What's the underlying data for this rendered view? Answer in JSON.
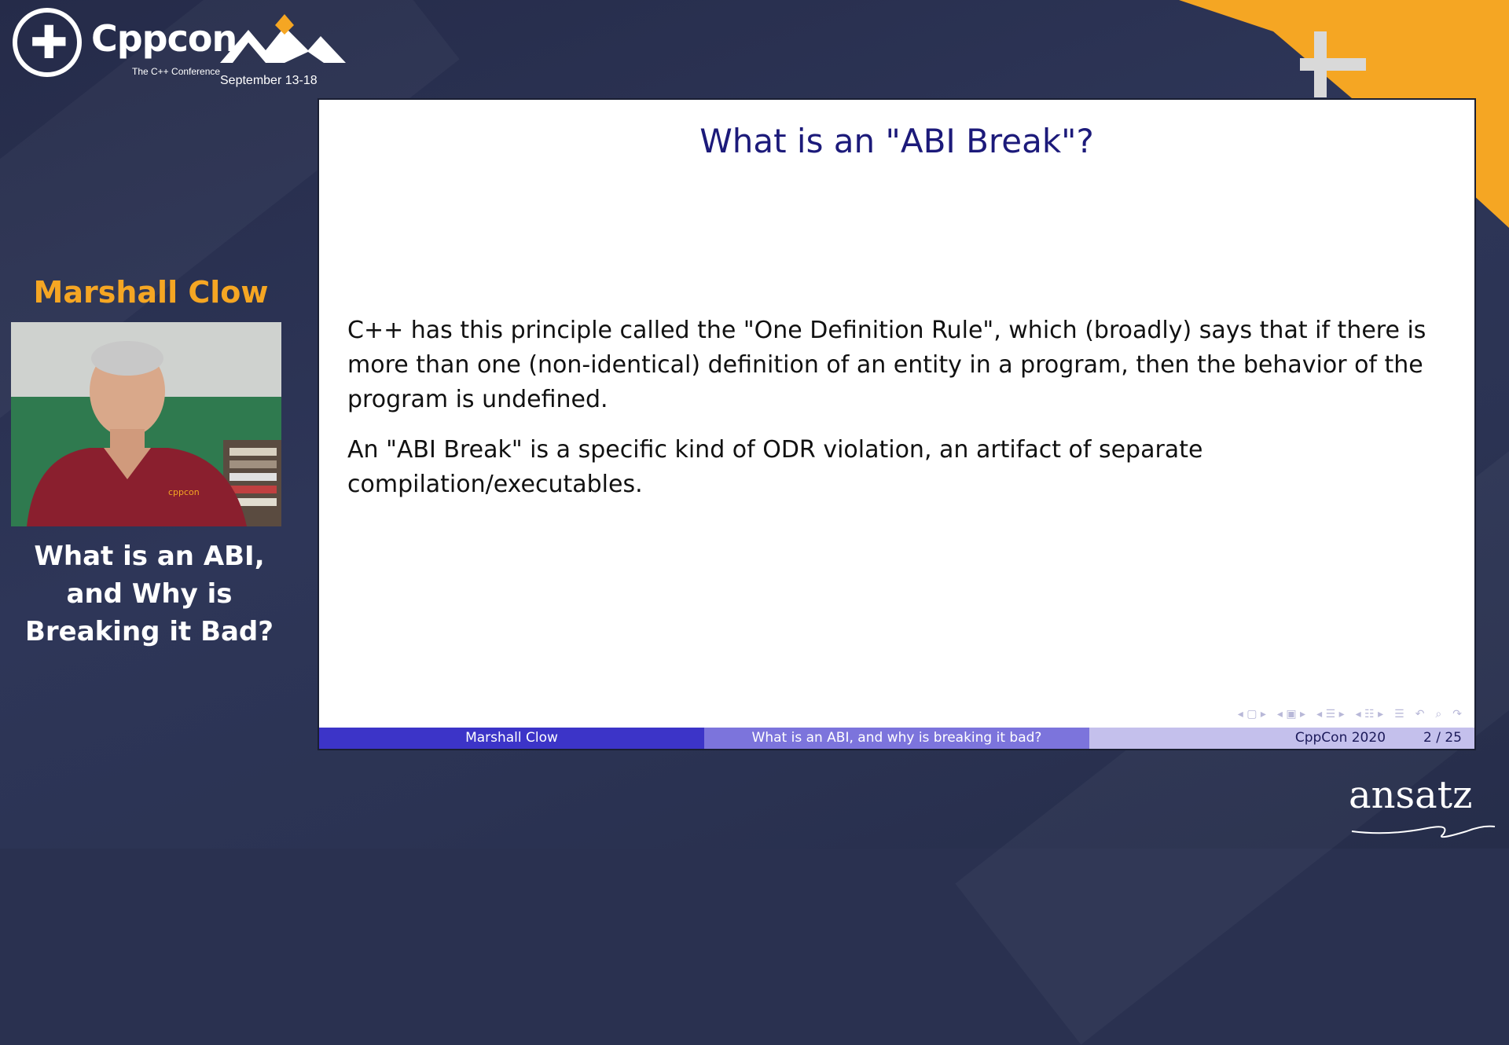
{
  "branding": {
    "logo_word": "Cppcon",
    "logo_subtitle": "The C++ Conference",
    "event_dates": "September 13-18",
    "sponsor": "ansatz",
    "accent_color": "#f5a623"
  },
  "speaker": {
    "name": "Marshall Clow",
    "talk_title": "What is an ABI, and Why is Breaking it Bad?",
    "shirt_logo": "cppcon"
  },
  "slide": {
    "title": "What is an \"ABI Break\"?",
    "paragraphs": [
      "C++ has this principle called the \"One Definition Rule\", which (broadly) says that if there is more than one (non-identical) definition of an entity in a program, then the behavior of the program is undefined.",
      "An \"ABI Break\" is a specific kind of ODR violation, an artifact of separate compilation/executables."
    ],
    "footer": {
      "author": "Marshall Clow",
      "short_title": "What is an ABI, and why is breaking it bad?",
      "conference": "CppCon 2020",
      "page": "2 / 25"
    },
    "nav_icons": [
      "nav-frame-icon",
      "nav-subsection-icon",
      "nav-section-icon",
      "nav-subsubsection-icon",
      "nav-outline-icon",
      "nav-back-icon",
      "search-icon",
      "nav-forward-icon"
    ]
  }
}
